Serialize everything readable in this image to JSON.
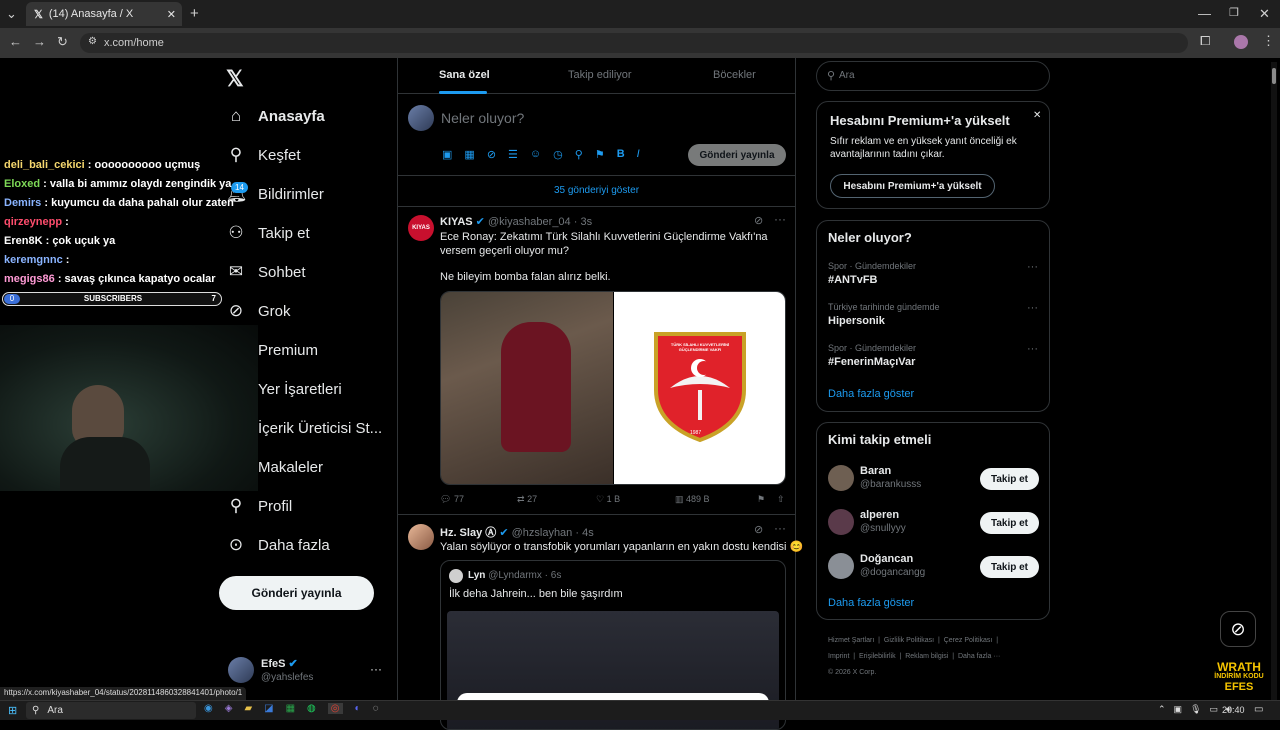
{
  "browser": {
    "tab_title": "(14) Anasayfa / X",
    "url": "x.com/home",
    "status_url": "https://x.com/kiyashaber_04/status/2028114860328841401/photo/1"
  },
  "nav": {
    "items": [
      {
        "label": "Anasayfa",
        "icon": "home-icon"
      },
      {
        "label": "Keşfet",
        "icon": "search-icon"
      },
      {
        "label": "Bildirimler",
        "icon": "bell-icon",
        "badge": "14"
      },
      {
        "label": "Takip et",
        "icon": "add-user-icon"
      },
      {
        "label": "Sohbet",
        "icon": "mail-icon"
      },
      {
        "label": "Grok",
        "icon": "grok-icon"
      },
      {
        "label": "Premium",
        "icon": "x-icon"
      },
      {
        "label": "Yer İşaretleri",
        "icon": "bookmark-icon"
      },
      {
        "label": "İçerik Üreticisi St...",
        "icon": "lightning-icon"
      },
      {
        "label": "Makaleler",
        "icon": "article-icon"
      },
      {
        "label": "Profil",
        "icon": "person-icon"
      },
      {
        "label": "Daha fazla",
        "icon": "more-circle-icon"
      }
    ],
    "post_button": "Gönderi yayınla",
    "account": {
      "name": "EfeS",
      "handle": "@yahslefes"
    }
  },
  "overlay": {
    "chat": [
      {
        "user": "deli_bali_cekici",
        "text": ": oooooooooo uçmuş",
        "color": "#f5d76e"
      },
      {
        "user": "Eloxed",
        "text": ": valla bi amımız olaydı zengindik ya",
        "color": "#7ed957"
      },
      {
        "user": "Demirs",
        "text": ": kuyumcu da daha pahalı olur zaten",
        "color": "#8ab4ff"
      },
      {
        "user": "qirzeynepp",
        "text": ":",
        "color": "#ff4d6d"
      },
      {
        "user": "Eren8K",
        "text": ": çok uçuk ya",
        "color": "#ffffff"
      },
      {
        "user": "keremgnnc",
        "text": ":",
        "color": "#8ab4ff"
      },
      {
        "user": "megigs86",
        "text": ": savaş çıkınca kapatyo ocalar",
        "color": "#ff9ad5"
      }
    ],
    "subs": {
      "label": "SUBSCRIBERS",
      "current": "0",
      "goal": "7"
    },
    "brand_line1": "WRATH",
    "brand_line2": "İNDİRİM KODU",
    "brand_line3": "EFES"
  },
  "feed": {
    "tabs": [
      "Sana özel",
      "Takip ediliyor",
      "Böcekler"
    ],
    "compose_placeholder": "Neler oluyor?",
    "compose_button": "Gönderi yayınla",
    "show_more": "35 gönderiyi göster",
    "tweets": [
      {
        "name": "KIYAS",
        "avatar_text": "KIYAS",
        "handle": "@kiyashaber_04",
        "time": "· 3s",
        "text1": "Ece Ronay: Zekatımı Türk Silahlı Kuvvetlerini Güçlendirme Vakfı'na versem geçerli oluyor mu?",
        "text2": "Ne bileyim bomba falan alırız belki.",
        "emblem_text": "TÜRK SİLAHLI KUVVETLERİNİ GÜÇLENDİRME VAKFI",
        "emblem_year": "1987",
        "replies": "77",
        "retweets": "27",
        "likes": "1 B",
        "views": "489 B"
      },
      {
        "name": "Hz. Slay Ⓐ",
        "handle": "@hzslayhan",
        "time": "· 4s",
        "text1": "Yalan söylüyor o transfobik yorumları yapanların en yakın dostu kendisi 😊",
        "quote": {
          "name": "Lyn",
          "handle": "@Lyndarmx",
          "time": "· 6s",
          "text": "İlk deha Jahrein... ben bile şaşırdım"
        }
      }
    ]
  },
  "right": {
    "search_placeholder": "Ara",
    "premium": {
      "title": "Hesabını Premium+'a yükselt",
      "desc": "Sıfır reklam ve en yüksek yanıt önceliği ek avantajlarının tadını çıkar.",
      "button": "Hesabını Premium+'a yükselt"
    },
    "trends": {
      "title": "Neler oluyor?",
      "items": [
        {
          "category": "Spor · Gündemdekiler",
          "name": "#ANTvFB"
        },
        {
          "category": "Türkiye tarihinde gündemde",
          "name": "Hipersonik"
        },
        {
          "category": "Spor · Gündemdekiler",
          "name": "#FenerinMaçıVar"
        }
      ],
      "more": "Daha fazla göster"
    },
    "follow": {
      "title": "Kimi takip etmeli",
      "items": [
        {
          "name": "Baran",
          "handle": "@barankusss"
        },
        {
          "name": "alperen",
          "handle": "@snullyyy"
        },
        {
          "name": "Doğancan",
          "handle": "@dogancangg"
        }
      ],
      "button": "Takip et",
      "more": "Daha fazla göster"
    },
    "footer": {
      "links": [
        "Hizmet Şartları",
        "Gizlilik Politikası",
        "Çerez Politikası",
        "Imprint",
        "Erişilebilirlik",
        "Reklam bilgisi",
        "Daha fazla ···"
      ],
      "copyright": "© 2026 X Corp."
    }
  },
  "taskbar": {
    "search": "Ara",
    "clock": "20:40"
  }
}
